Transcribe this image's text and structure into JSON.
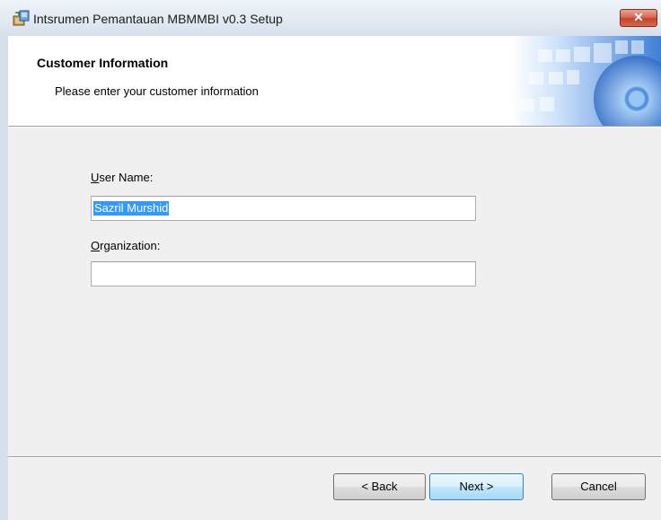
{
  "window": {
    "title": "Intsrumen Pemantauan MBMMBI v0.3 Setup",
    "close_glyph": "✕"
  },
  "header": {
    "title": "Customer Information",
    "subtitle": "Please enter your customer information"
  },
  "form": {
    "user_name": {
      "label_accel": "U",
      "label_rest": "ser Name:",
      "value": "Sazril Murshid",
      "selected": true
    },
    "organization": {
      "label_accel": "O",
      "label_rest": "rganization:",
      "value": ""
    }
  },
  "buttons": {
    "back": "< Back",
    "next": "Next >",
    "cancel": "Cancel"
  },
  "colors": {
    "selection": "#3399ff",
    "close_button": "#c4442a",
    "banner_blue": "#2e6fc7"
  },
  "icons": {
    "app": "installer-icon",
    "close": "close-icon"
  }
}
